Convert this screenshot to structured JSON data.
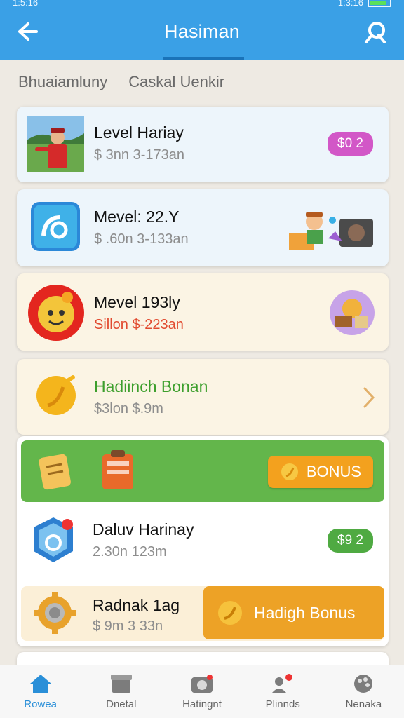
{
  "status": {
    "time": "1:5:16",
    "right_time": "1:3:16"
  },
  "appbar": {
    "title": "Hasiman"
  },
  "tabs": [
    "Bhuaiamluny",
    "Caskal Uenkir"
  ],
  "cards": [
    {
      "title": "Level Hariay",
      "subtitle": "$ 3nn 3-173an",
      "badge": "$0 2",
      "badge_color": "#d257c7"
    },
    {
      "title": "Mevel: 22.Y",
      "subtitle": "$ .60n 3-133an"
    },
    {
      "title": "Mevel 193ly",
      "subtitle": "Sillon $-223an",
      "subtitle_color": "#e14a2f"
    },
    {
      "title": "Hadiinch Bonan",
      "subtitle": "$3lon $.9m",
      "title_color": "#3d9f2d"
    }
  ],
  "bonus": {
    "button_label": "BONUS",
    "row1": {
      "title": "Daluv Harinay",
      "subtitle": "2.30n 123m",
      "badge": "$9 2",
      "badge_color": "#4faa42"
    },
    "row2": {
      "title": "Radnak 1ag",
      "subtitle": "$ 9m 3 33n",
      "button_label": "Hadigh Bonus"
    }
  },
  "bottom_nav": [
    {
      "label": "Rowea",
      "icon": "home-icon",
      "active": true
    },
    {
      "label": "Dnetal",
      "icon": "box-icon"
    },
    {
      "label": "Hatingnt",
      "icon": "camera-icon"
    },
    {
      "label": "Plinnds",
      "icon": "people-icon"
    },
    {
      "label": "Nenaka",
      "icon": "palette-icon"
    }
  ],
  "colors": {
    "appbar": "#3aa0e6",
    "green_banner": "#63b64b",
    "orange": "#f3a11e",
    "nav_active": "#2a8fd8"
  }
}
